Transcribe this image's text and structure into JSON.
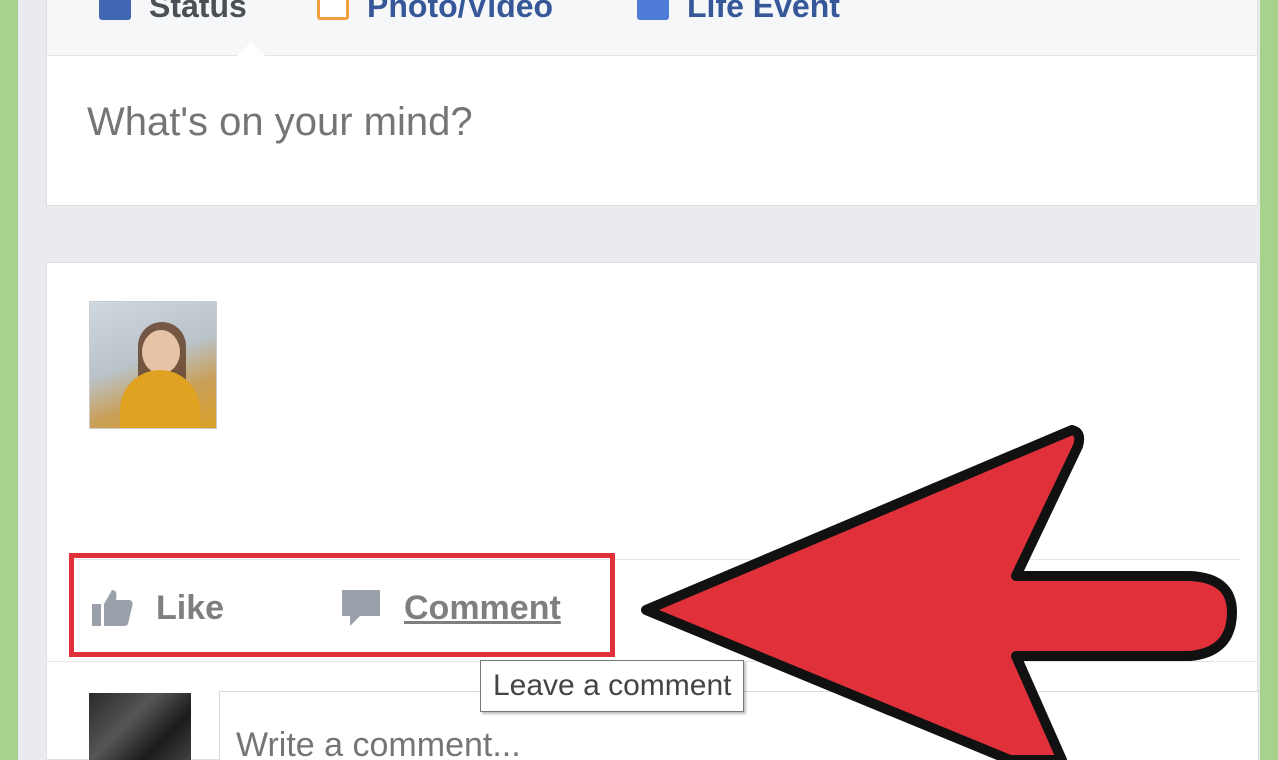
{
  "composer": {
    "tabs": [
      {
        "label": "Status",
        "icon": "pencil-icon"
      },
      {
        "label": "Photo/Video",
        "icon": "photo-icon"
      },
      {
        "label": "Life Event",
        "icon": "flag-icon"
      }
    ],
    "placeholder": "What's on your mind?"
  },
  "post": {
    "actions": {
      "like_label": "Like",
      "comment_label": "Comment"
    },
    "comment_placeholder": "Write a comment...",
    "tooltip": "Leave a comment"
  },
  "annotation": {
    "highlight_color": "#e0313b",
    "arrow_color": "#e0313b"
  }
}
